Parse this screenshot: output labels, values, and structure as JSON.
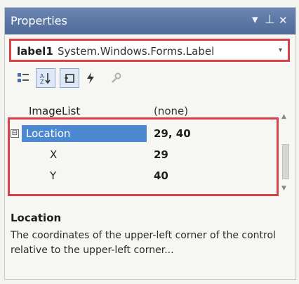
{
  "window": {
    "title": "Properties",
    "controls": {
      "dropdown": "▾",
      "pin": "⊥",
      "close": "✕"
    }
  },
  "object_selector": {
    "object_name": "label1",
    "object_type": "System.Windows.Forms.Label",
    "arrow": "▾"
  },
  "toolbar": {
    "buttons": [
      {
        "name": "categorized-button-icon",
        "active": false
      },
      {
        "name": "alphabetical-button-icon",
        "active": true
      },
      {
        "name": "properties-button-icon",
        "active": true
      },
      {
        "name": "events-button-icon",
        "active": false
      },
      {
        "name": "property-pages-button-icon",
        "active": false
      }
    ]
  },
  "grid": {
    "rows": [
      {
        "name": "ImageList",
        "value": "(none)"
      },
      {
        "name": "Location",
        "value": "29, 40",
        "expander": "⊟"
      },
      {
        "name": "X",
        "value": "29"
      },
      {
        "name": "Y",
        "value": "40"
      }
    ]
  },
  "description": {
    "title": "Location",
    "text": "The coordinates of the upper-left corner of the control relative to the upper-left corner..."
  },
  "colors": {
    "title_bar": "#5a74a3",
    "selection": "#4c89d1",
    "highlight_annotation": "#d84148"
  }
}
